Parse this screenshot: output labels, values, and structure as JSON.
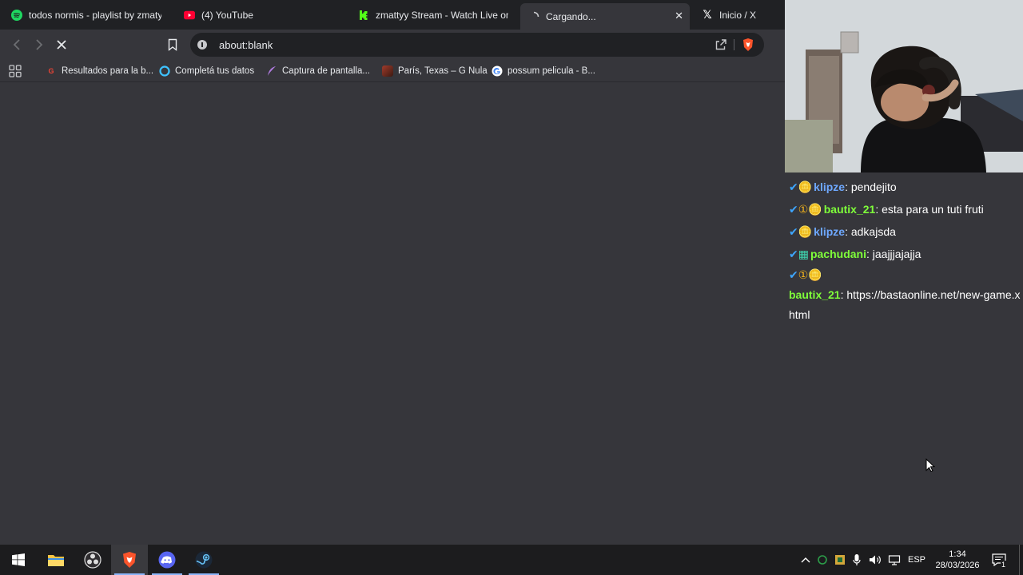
{
  "tabs": [
    {
      "title": "todos normis - playlist by zmatyy | Spotify",
      "icon": "spotify-icon"
    },
    {
      "title": "(4) YouTube",
      "icon": "youtube-icon"
    },
    {
      "title": "zmattyy Stream - Watch Live on Kick",
      "icon": "kick-icon"
    },
    {
      "title": "Cargando...",
      "icon": "loading-icon",
      "active": true
    },
    {
      "title": "Inicio / X",
      "icon": "x-icon"
    }
  ],
  "toolbar": {
    "address": "about:blank"
  },
  "bookmarks": [
    {
      "label": "Resultados para la b...",
      "icon": "google-g-icon"
    },
    {
      "label": "Completá tus datos",
      "icon": "circle-icon"
    },
    {
      "label": "Captura de pantalla...",
      "icon": "feather-icon"
    },
    {
      "label": "París, Texas – G Nula",
      "icon": "image-icon"
    },
    {
      "label": "possum pelicula - B...",
      "icon": "google-icon"
    }
  ],
  "chat": [
    {
      "user": "klipze",
      "sep": ": ",
      "text": "pendejito",
      "color": "#6ea8ff"
    },
    {
      "user": "bautix_21",
      "sep": ": ",
      "text": "esta para un tuti fruti",
      "color": "#7fff3a"
    },
    {
      "user": "klipze",
      "sep": ": ",
      "text": "adkajsda",
      "color": "#6ea8ff"
    },
    {
      "user": "pachudani",
      "sep": ": ",
      "text": "jaajjjajajja",
      "color": "#7fff3a"
    },
    {
      "user": "bautix_21",
      "sep": ": ",
      "text": "https://bastaonline.net/new-game.xhtml",
      "color": "#7fff3a"
    }
  ],
  "tray": {
    "lang": "ESP",
    "time": "1:34",
    "date": "28/03/2026",
    "notifications": "1"
  },
  "colors": {
    "page_bg": "#36363b",
    "tabbar_bg": "#202124",
    "taskbar_bg": "#1c1c1e",
    "chat_user_blue": "#6ea8ff",
    "chat_user_green": "#7fff3a"
  }
}
